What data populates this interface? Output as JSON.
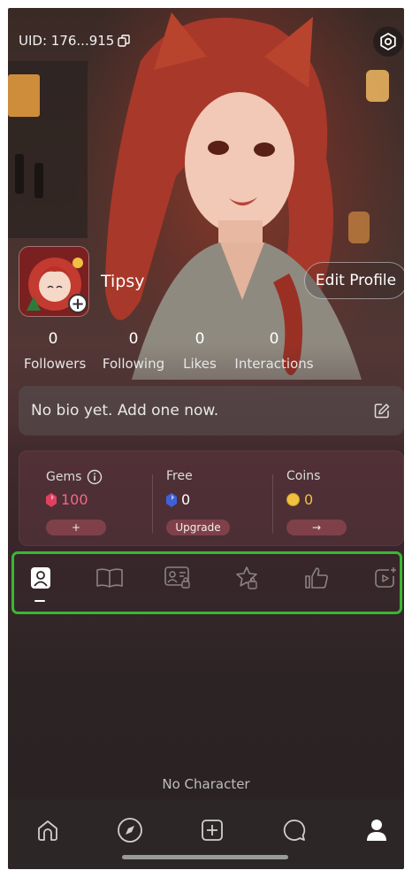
{
  "profile": {
    "uid": "UID: 176...915",
    "name": "Tipsy",
    "edit_label": "Edit Profile"
  },
  "stats": [
    {
      "value": "0",
      "label": "Followers"
    },
    {
      "value": "0",
      "label": "Following"
    },
    {
      "value": "0",
      "label": "Likes"
    },
    {
      "value": "0",
      "label": "Interactions"
    }
  ],
  "bio": {
    "placeholder": "No bio yet. Add one now."
  },
  "wallet": {
    "gems": {
      "label": "Gems",
      "value": "100",
      "button": "+"
    },
    "free": {
      "label": "Free",
      "value": "0",
      "button": "Upgrade"
    },
    "coins": {
      "label": "Coins",
      "value": "0",
      "button": "→"
    }
  },
  "tabs": [
    {
      "icon": "person-card-icon",
      "active": true
    },
    {
      "icon": "book-icon",
      "active": false
    },
    {
      "icon": "id-card-lock-icon",
      "active": false
    },
    {
      "icon": "star-lock-icon",
      "active": false
    },
    {
      "icon": "thumbs-up-icon",
      "active": false
    },
    {
      "icon": "video-add-icon",
      "active": false
    }
  ],
  "empty_state": "No Character",
  "bottom_nav": [
    {
      "icon": "home-icon"
    },
    {
      "icon": "compass-icon"
    },
    {
      "icon": "add-square-icon"
    },
    {
      "icon": "chat-bubble-icon"
    },
    {
      "icon": "profile-icon",
      "active": true
    }
  ],
  "colors": {
    "highlight": "#39b833",
    "gem": "#e04060",
    "accent_bar": "#ffffff"
  }
}
